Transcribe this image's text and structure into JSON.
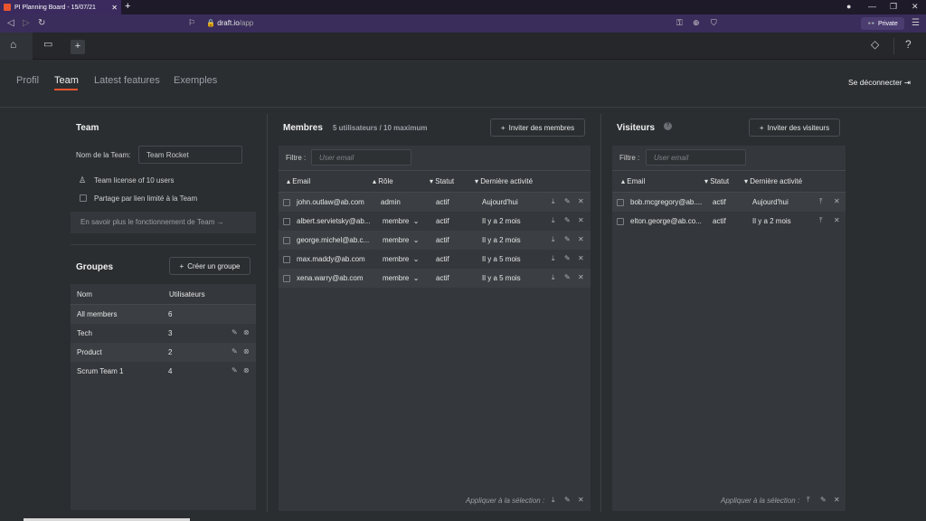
{
  "browser": {
    "tab_title": "PI Planning Board - 15/07/21",
    "url_host": "draft.io",
    "url_path": "/app",
    "private_label": "Private"
  },
  "nav": {
    "tabs": [
      "Profil",
      "Team",
      "Latest features",
      "Exemples"
    ],
    "active_tab": "Team",
    "logout": "Se déconnecter"
  },
  "team": {
    "title": "Team",
    "name_label": "Nom de la Team:",
    "name_value": "Team Rocket",
    "license": "Team license of 10 users",
    "share_label": "Partage par lien limité à la Team",
    "learn_more": "En savoir plus le fonctionnement de Team →"
  },
  "groups": {
    "title": "Groupes",
    "create_button": "Créer un groupe",
    "col_name": "Nom",
    "col_users": "Utilisateurs",
    "rows": [
      {
        "name": "All members",
        "count": "6"
      },
      {
        "name": "Tech",
        "count": "3"
      },
      {
        "name": "Product",
        "count": "2"
      },
      {
        "name": "Scrum Team 1",
        "count": "4"
      }
    ]
  },
  "members": {
    "title": "Membres",
    "subtitle": "5 utilisateurs / 10 maximum",
    "invite_button": "Inviter des membres",
    "filter_label": "Filtre :",
    "filter_placeholder": "User email",
    "col_email": "Email",
    "col_role": "Rôle",
    "col_status": "Statut",
    "col_activity": "Dernière activité",
    "rows": [
      {
        "email": "john.outlaw@ab.com",
        "role": "admin",
        "status": "actif",
        "activity": "Aujourd'hui"
      },
      {
        "email": "albert.servietsky@ab...",
        "role": "membre",
        "status": "actif",
        "activity": "Il y a 2 mois"
      },
      {
        "email": "george.michel@ab.c...",
        "role": "membre",
        "status": "actif",
        "activity": "Il y a 2 mois"
      },
      {
        "email": "max.maddy@ab.com",
        "role": "membre",
        "status": "actif",
        "activity": "Il y a 5 mois"
      },
      {
        "email": "xena.warry@ab.com",
        "role": "membre",
        "status": "actif",
        "activity": "Il y a 5 mois"
      }
    ],
    "apply_label": "Appliquer à la sélection :"
  },
  "visitors": {
    "title": "Visiteurs",
    "invite_button": "Inviter des visiteurs",
    "filter_label": "Filtre :",
    "filter_placeholder": "User email",
    "col_email": "Email",
    "col_status": "Statut",
    "col_activity": "Dernière activité",
    "rows": [
      {
        "email": "bob.mcgregory@ab....",
        "status": "actif",
        "activity": "Aujourd'hui"
      },
      {
        "email": "elton.george@ab.co...",
        "status": "actif",
        "activity": "Il y a 2 mois"
      }
    ],
    "apply_label": "Appliquer à la sélection :"
  },
  "colors": {
    "accent": "#e8542d",
    "background": "#2b2e31",
    "panel": "#34373b"
  }
}
